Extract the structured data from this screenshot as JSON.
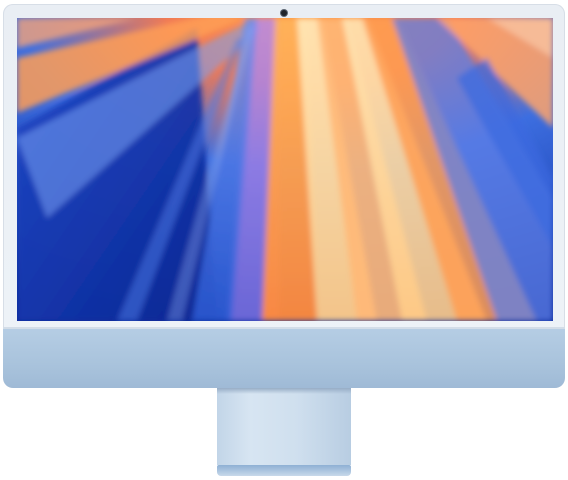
{
  "device": {
    "type": "all-in-one desktop computer",
    "colors": {
      "bezel": "#eef3f8",
      "chin": "#abc5de",
      "stand": "#cfdfee",
      "foot": "#9fbad8",
      "wallpaper_dark": "#0f2c9c",
      "wallpaper_light": "#ffd9a0"
    },
    "icons": {
      "camera": "camera-icon"
    }
  }
}
